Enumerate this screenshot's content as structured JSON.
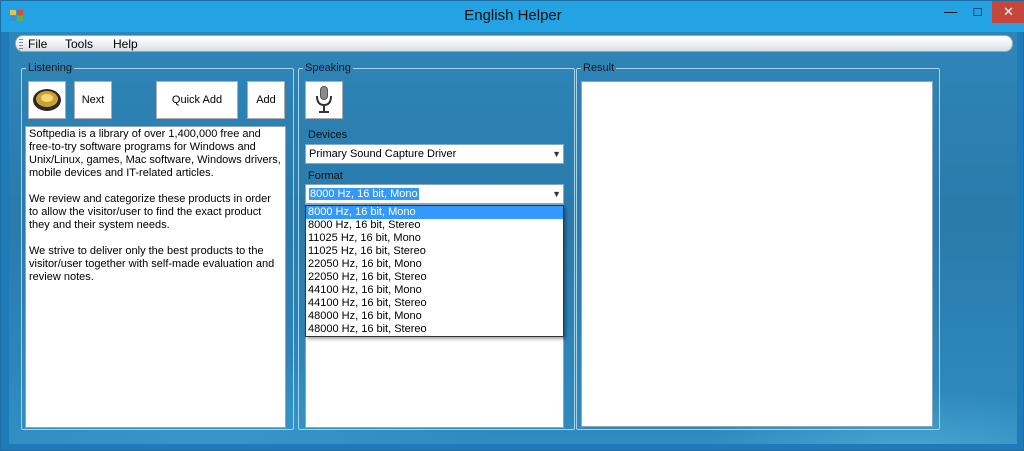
{
  "window": {
    "title": "English Helper",
    "controls": {
      "minimize": "—",
      "maximize": "□",
      "close": "✕"
    }
  },
  "menu": {
    "items": [
      {
        "label": "File"
      },
      {
        "label": "Tools"
      },
      {
        "label": "Help"
      }
    ]
  },
  "listening": {
    "title": "Listening",
    "speaker_icon": "speaker-icon",
    "buttons": {
      "next": "Next",
      "quick_add": "Quick Add",
      "add": "Add"
    },
    "text": [
      "Softpedia is a library of over 1,400,000 free and free-to-try software programs for Windows and Unix/Linux, games, Mac software, Windows drivers, mobile devices and IT-related articles.",
      "We review and categorize these products in order to allow the visitor/user to find the exact product they and their system needs.",
      "We strive to deliver only the best products to the visitor/user together with self-made evaluation and review notes."
    ]
  },
  "speaking": {
    "title": "Speaking",
    "mic_icon": "microphone-icon",
    "devices_label": "Devices",
    "device_value": "Primary Sound Capture Driver",
    "format_label": "Format",
    "format_value": "8000 Hz, 16 bit, Mono",
    "format_options": [
      "8000 Hz, 16 bit, Mono",
      "8000 Hz, 16 bit, Stereo",
      "11025 Hz, 16 bit, Mono",
      "11025 Hz, 16 bit, Stereo",
      "22050 Hz, 16 bit, Mono",
      "22050 Hz, 16 bit, Stereo",
      "44100 Hz, 16 bit, Mono",
      "44100 Hz, 16 bit, Stereo",
      "48000 Hz, 16 bit, Mono",
      "48000 Hz, 16 bit, Stereo"
    ],
    "selected_index": 0
  },
  "result": {
    "title": "Result"
  },
  "colors": {
    "titlebar": "#23a3e4",
    "close_button": "#c7463c",
    "selection": "#3399ff"
  }
}
